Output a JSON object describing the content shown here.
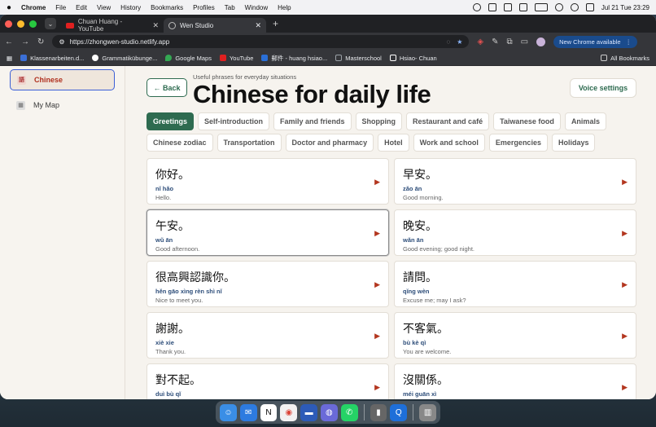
{
  "menubar": {
    "app_name": "Chrome",
    "items": [
      "File",
      "Edit",
      "View",
      "History",
      "Bookmarks",
      "Profiles",
      "Tab",
      "Window",
      "Help"
    ],
    "clock": "Jul 21 Tue  23:29"
  },
  "browser": {
    "tabs": [
      {
        "label": "Chuan Huang - YouTube"
      },
      {
        "label": "Wen Studio"
      }
    ],
    "new_tab": "+",
    "url": "https://zhongwen-studio.netlify.app",
    "chrome_available": "New Chrome available",
    "bookmarks": [
      {
        "label": "Klassenarbeiten.d...",
        "color": "#3b6fd6"
      },
      {
        "label": "Grammatikübunge...",
        "color": "#ffffff"
      },
      {
        "label": "Google Maps",
        "color": "#34a853"
      },
      {
        "label": "YouTube",
        "color": "#e02020"
      },
      {
        "label": "郵件 - huang hsiao...",
        "color": "#2a6fd6"
      },
      {
        "label": "Masterschool",
        "color": "#9aa0a6"
      },
      {
        "label": "Hsiao- Chuan",
        "color": "#ffffff"
      }
    ],
    "all_bookmarks": "All Bookmarks"
  },
  "sidebar": {
    "items": [
      {
        "label": "Chinese",
        "icon": "語"
      },
      {
        "label": "My Map",
        "icon": "▦"
      }
    ]
  },
  "header": {
    "back_label": "← Back",
    "subtitle": "Useful phrases for everyday situations",
    "title": "Chinese for daily life",
    "voice_label": "Voice settings"
  },
  "categories": [
    "Greetings",
    "Self-introduction",
    "Family and friends",
    "Shopping",
    "Restaurant and café",
    "Taiwanese food",
    "Animals",
    "Chinese zodiac",
    "Transportation",
    "Doctor and pharmacy",
    "Hotel",
    "Work and school",
    "Emergencies",
    "Holidays"
  ],
  "phrases": [
    {
      "zh": "你好。",
      "pinyin": "nǐ hǎo",
      "en": "Hello."
    },
    {
      "zh": "早安。",
      "pinyin": "zǎo ān",
      "en": "Good morning."
    },
    {
      "zh": "午安。",
      "pinyin": "wǔ ān",
      "en": "Good afternoon."
    },
    {
      "zh": "晚安。",
      "pinyin": "wǎn ān",
      "en": "Good evening; good night."
    },
    {
      "zh": "很高興認識你。",
      "pinyin": "hěn gāo xìng rèn shì nǐ",
      "en": "Nice to meet you."
    },
    {
      "zh": "請問。",
      "pinyin": "qǐng wèn",
      "en": "Excuse me; may I ask?"
    },
    {
      "zh": "謝謝。",
      "pinyin": "xiè xie",
      "en": "Thank you."
    },
    {
      "zh": "不客氣。",
      "pinyin": "bù kè qì",
      "en": "You are welcome."
    },
    {
      "zh": "對不起。",
      "pinyin": "duì bù qǐ",
      "en": ""
    },
    {
      "zh": "沒關係。",
      "pinyin": "méi guān xì",
      "en": ""
    }
  ],
  "play_symbol": "▶"
}
